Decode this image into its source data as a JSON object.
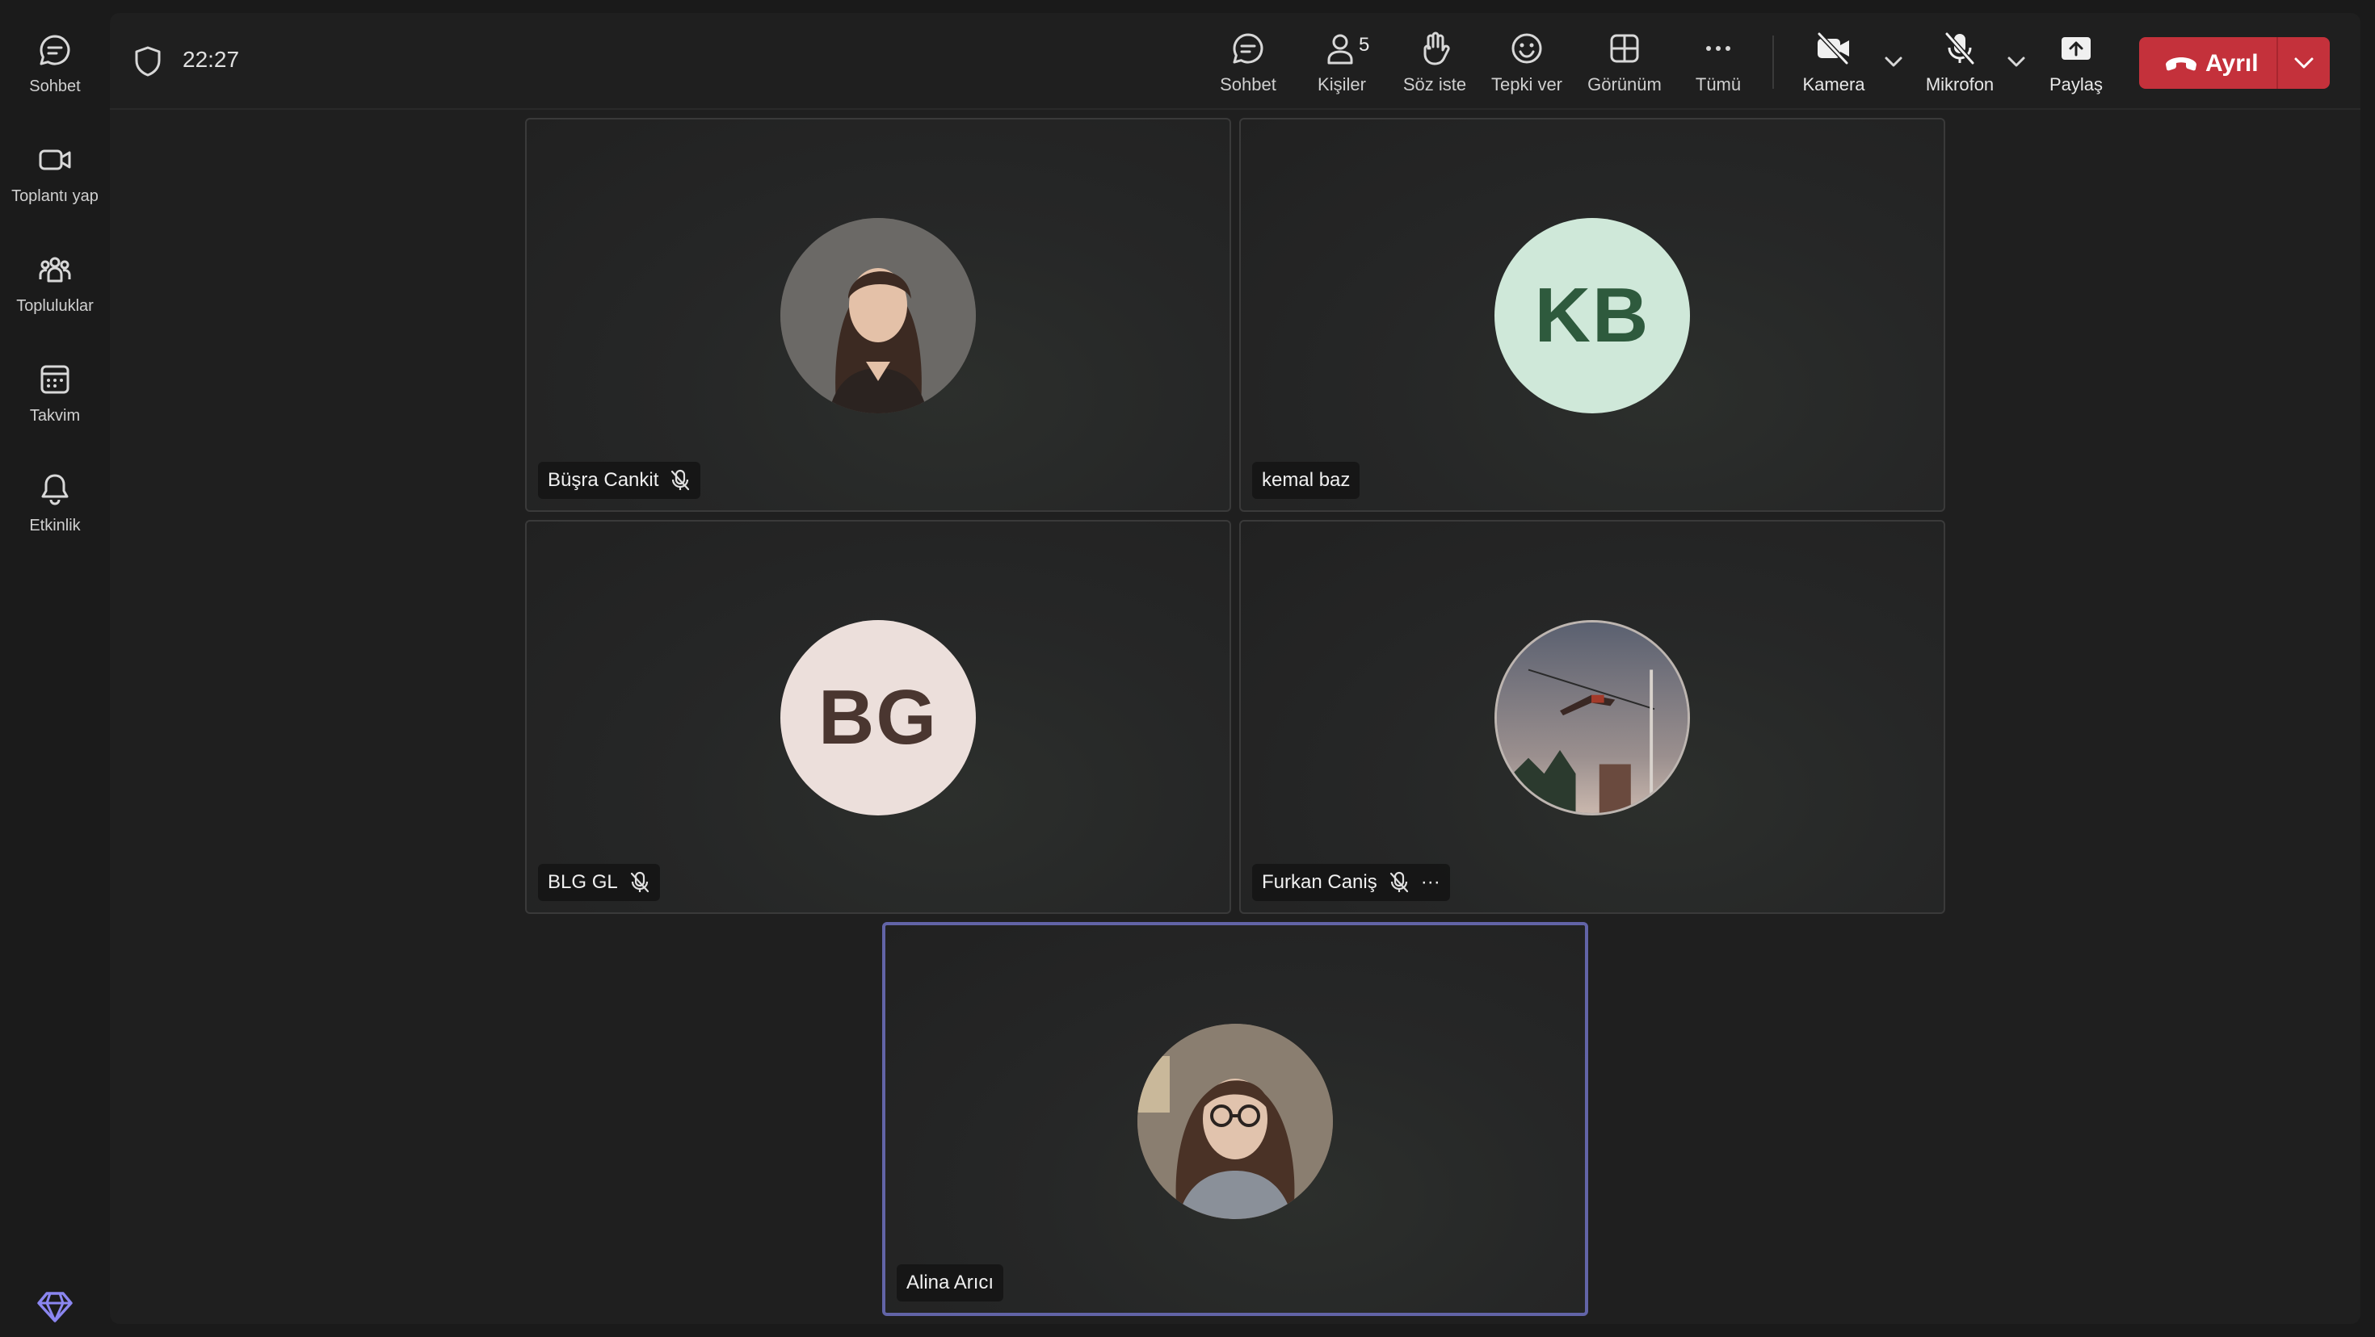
{
  "rail": {
    "items": [
      {
        "label": "Sohbet",
        "icon": "chat-icon"
      },
      {
        "label": "Toplantı yap",
        "icon": "video-icon"
      },
      {
        "label": "Topluluklar",
        "icon": "communities-icon"
      },
      {
        "label": "Takvim",
        "icon": "calendar-icon"
      },
      {
        "label": "Etkinlik",
        "icon": "bell-icon"
      }
    ],
    "bottom_icon": "premium-diamond-icon"
  },
  "meeting": {
    "timer": "22:27",
    "toolbar": {
      "chat": "Sohbet",
      "people": "Kişiler",
      "people_count": "5",
      "raise_hand": "Söz iste",
      "react": "Tepki ver",
      "view": "Görünüm",
      "more": "Tümü",
      "camera": "Kamera",
      "mic": "Mikrofon",
      "share": "Paylaş",
      "leave": "Ayrıl"
    }
  },
  "participants": [
    {
      "name": "Büşra Cankit",
      "initials": "",
      "muted": true,
      "avatar": "photo"
    },
    {
      "name": "kemal baz",
      "initials": "KB",
      "muted": false,
      "avatar": "initials",
      "avatar_bg": "#cfe8d9",
      "avatar_fg": "#2e5a3d"
    },
    {
      "name": "BLG GL",
      "initials": "BG",
      "muted": true,
      "avatar": "initials",
      "avatar_bg": "#ecdfdb",
      "avatar_fg": "#4a3630"
    },
    {
      "name": "Furkan Caniş",
      "initials": "",
      "muted": true,
      "avatar": "photo",
      "more": "···"
    },
    {
      "name": "Alina Arıcı",
      "initials": "",
      "muted": false,
      "avatar": "photo",
      "active": true
    }
  ],
  "colors": {
    "accent": "#6264a7",
    "leave": "#c4313b",
    "background": "#1f1f1f"
  }
}
